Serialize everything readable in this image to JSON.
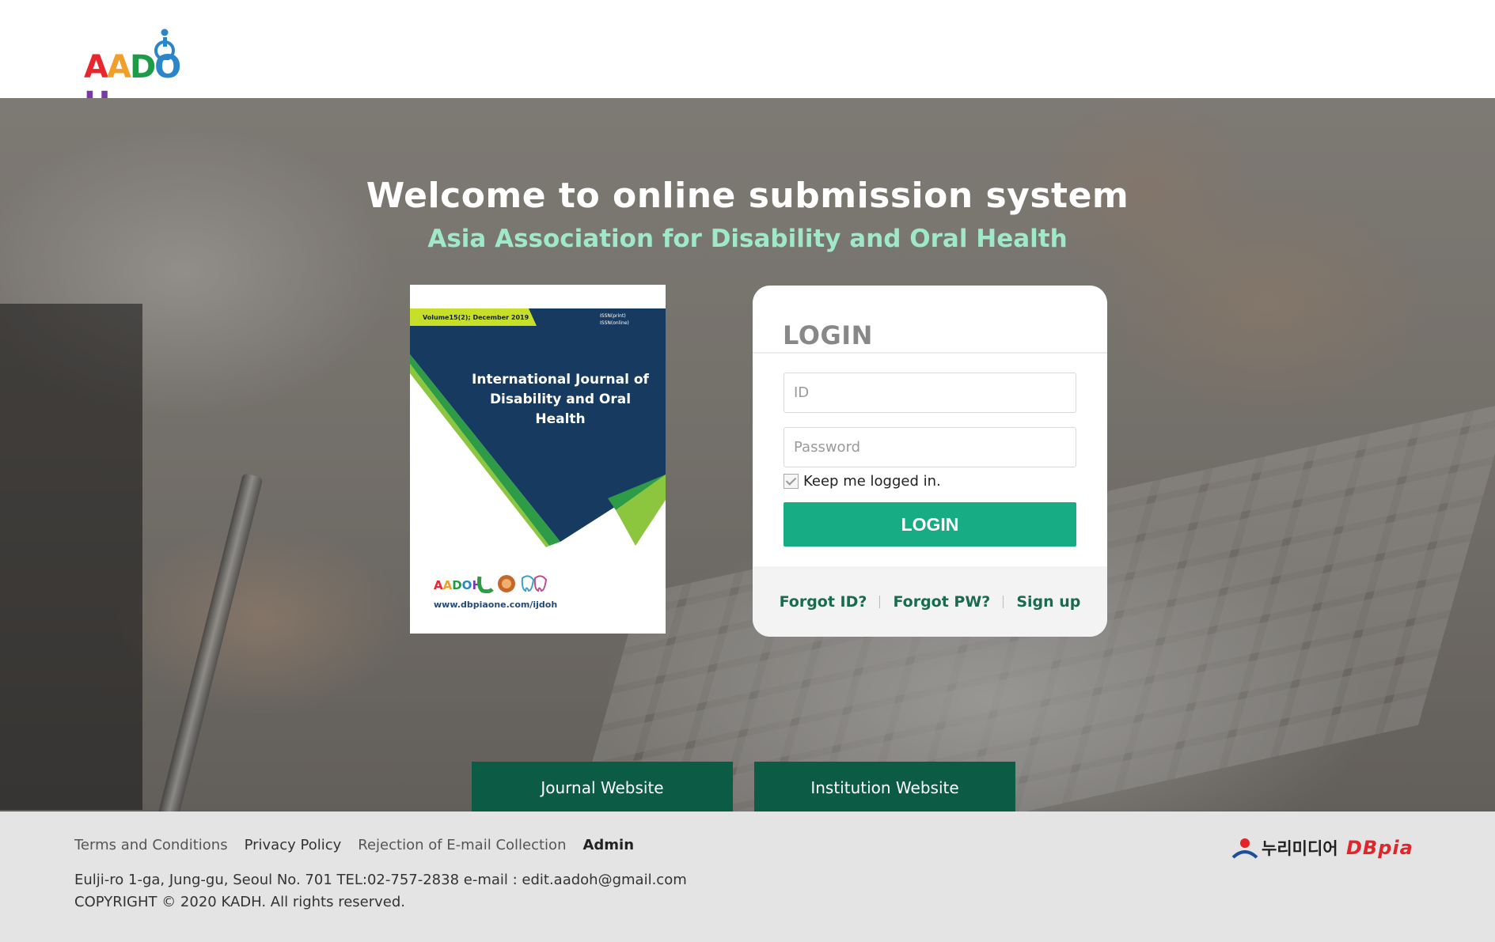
{
  "header": {
    "logo_text": "AADOH",
    "logo_letters": [
      {
        "char": "A",
        "color": "#e8262d"
      },
      {
        "char": "A",
        "color": "#f0a02a"
      },
      {
        "char": "D",
        "color": "#1d9b48"
      },
      {
        "char": "O",
        "color": "#2a86c9"
      },
      {
        "char": "H",
        "color": "#7a3aa6"
      }
    ]
  },
  "hero": {
    "title": "Welcome to online submission system",
    "subtitle": "Asia Association for Disability and Oral Health"
  },
  "cover": {
    "volume": "Volume15(2); December 2019",
    "issn_print": "ISSN(print)",
    "issn_online": "ISSN(online)",
    "journal_title": "International Journal of Disability and Oral Health",
    "url": "www.dbpiaone.com/ijdoh",
    "colors": {
      "navy": "#173b60",
      "lime": "#8cc63f",
      "green": "#2e9b46"
    }
  },
  "login": {
    "heading": "LOGIN",
    "id_placeholder": "ID",
    "password_placeholder": "Password",
    "keep_logged_in": "Keep me logged in.",
    "keep_checked": true,
    "submit_label": "LOGIN",
    "forgot_id": "Forgot ID?",
    "forgot_pw": "Forgot PW?",
    "sign_up": "Sign up",
    "accent_color": "#17ac83"
  },
  "site_links": {
    "journal": "Journal Website",
    "institution": "Institution Website"
  },
  "footer": {
    "links": {
      "terms": "Terms and Conditions",
      "privacy": "Privacy Policy",
      "email_rejection": "Rejection of E-mail Collection",
      "admin": "Admin"
    },
    "address": "Eulji-ro 1-ga, Jung-gu, Seoul No. 701 TEL:02-757-2838 e-mail : edit.aadoh@gmail.com",
    "copyright": "COPYRIGHT © 2020 KADH. All rights reserved.",
    "partner_nuri": "누리미디어",
    "partner_dbpia": "DBpia"
  }
}
